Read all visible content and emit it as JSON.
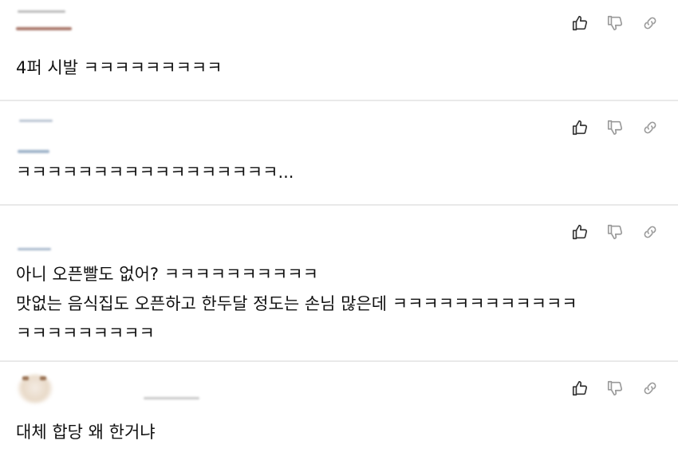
{
  "icons": {
    "like": "thumbs-up-icon",
    "dislike": "thumbs-down-icon",
    "share": "link-icon"
  },
  "comments": [
    {
      "lines": [
        "4퍼 시발 ㅋㅋㅋㅋㅋㅋㅋㅋㅋ"
      ]
    },
    {
      "lines": [
        "ㅋㅋㅋㅋㅋㅋㅋㅋㅋㅋㅋㅋㅋㅋㅋㅋㅋ..."
      ]
    },
    {
      "lines": [
        "아니 오픈빨도 없어? ㅋㅋㅋㅋㅋㅋㅋㅋㅋㅋ",
        "맛없는 음식집도 오픈하고 한두달 정도는 손님 많은데 ㅋㅋㅋㅋㅋㅋㅋㅋㅋㅋㅋㅋ",
        "ㅋㅋㅋㅋㅋㅋㅋㅋㅋ"
      ]
    },
    {
      "lines": [
        "대체 합당 왜 한거냐"
      ]
    }
  ]
}
